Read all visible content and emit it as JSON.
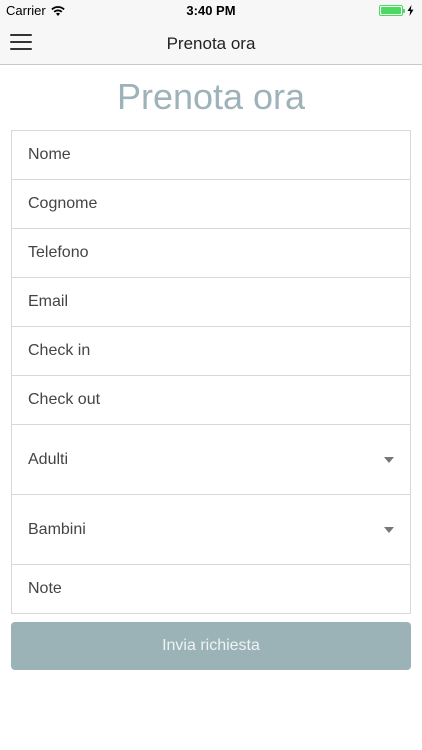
{
  "status_bar": {
    "carrier": "Carrier",
    "time": "3:40 PM",
    "battery_level": 1.0,
    "battery_color": "#4cd964"
  },
  "nav": {
    "title": "Prenota ora",
    "menu_icon": "hamburger-menu-icon"
  },
  "page": {
    "heading": "Prenota ora"
  },
  "form": {
    "fields": [
      {
        "placeholder": "Nome"
      },
      {
        "placeholder": "Cognome"
      },
      {
        "placeholder": "Telefono"
      },
      {
        "placeholder": "Email"
      },
      {
        "placeholder": "Check in"
      },
      {
        "placeholder": "Check out"
      }
    ],
    "selects": [
      {
        "label": "Adulti"
      },
      {
        "label": "Bambini"
      }
    ],
    "note": {
      "placeholder": "Note"
    },
    "submit_label": "Invia richiesta"
  },
  "colors": {
    "accent": "#9db2b9",
    "button": "#9bb3b7"
  }
}
